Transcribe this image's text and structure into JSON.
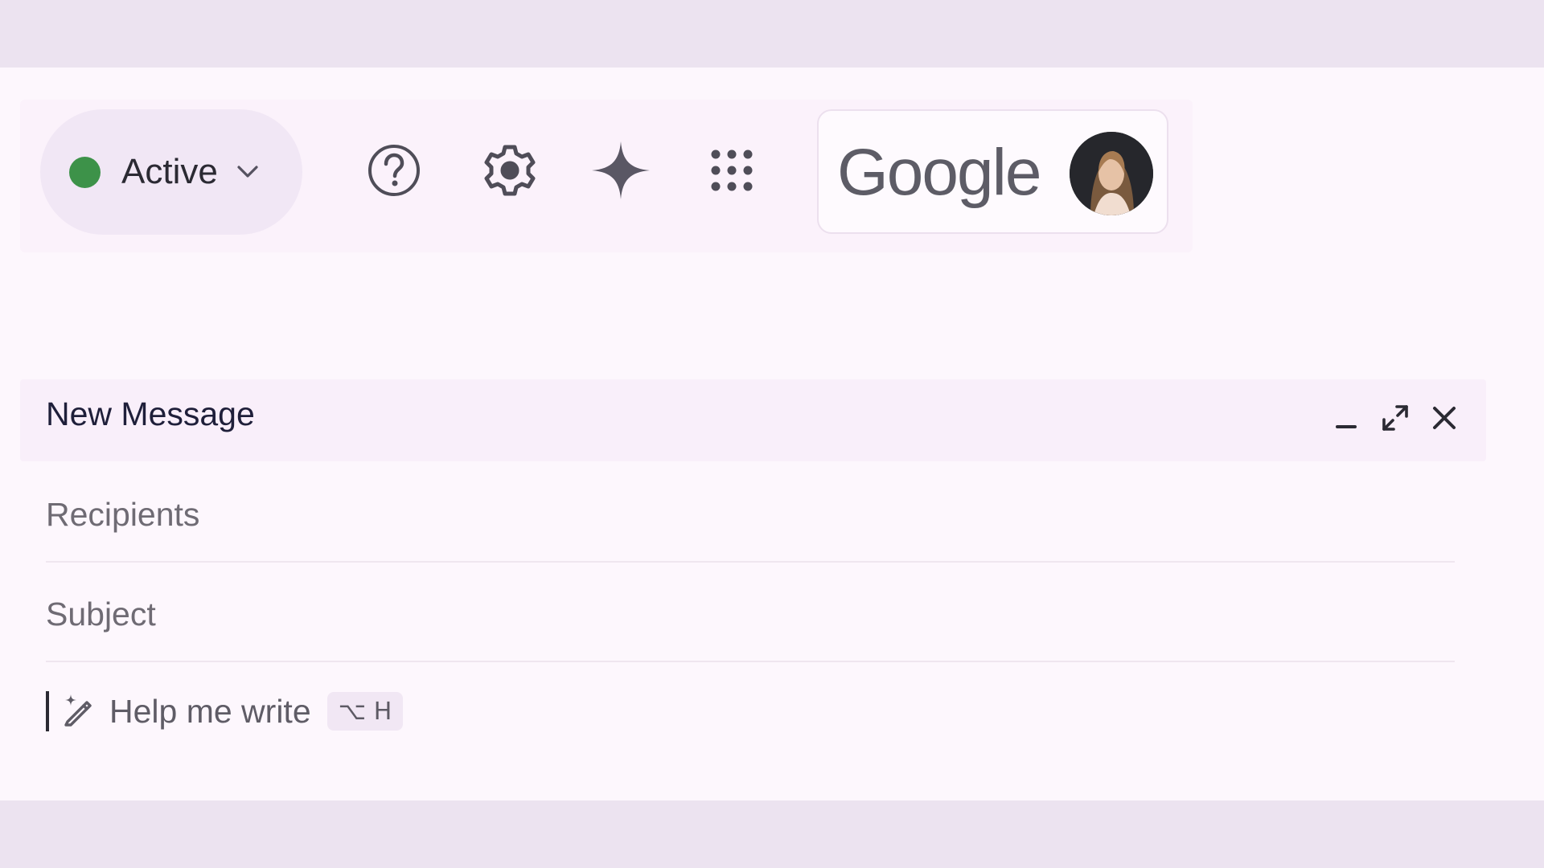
{
  "header": {
    "status": {
      "label": "Active",
      "dot_color": "#3d9249",
      "icon": "chevron-down-icon"
    },
    "icons": [
      "help-icon",
      "gear-icon",
      "gemini-sparkle-icon",
      "apps-grid-icon"
    ],
    "account": {
      "brand": "Google",
      "avatar": "user-avatar"
    }
  },
  "compose": {
    "title": "New Message",
    "controls": [
      "minimize-icon",
      "expand-icon",
      "close-icon"
    ],
    "recipients_placeholder": "Recipients",
    "subject_placeholder": "Subject",
    "help_me_write": {
      "label": "Help me write",
      "shortcut": "⌥ H"
    }
  },
  "colors": {
    "accent_green": "#3d9249",
    "text_dark": "#1f1f3a",
    "background": "#fdf7fd"
  }
}
